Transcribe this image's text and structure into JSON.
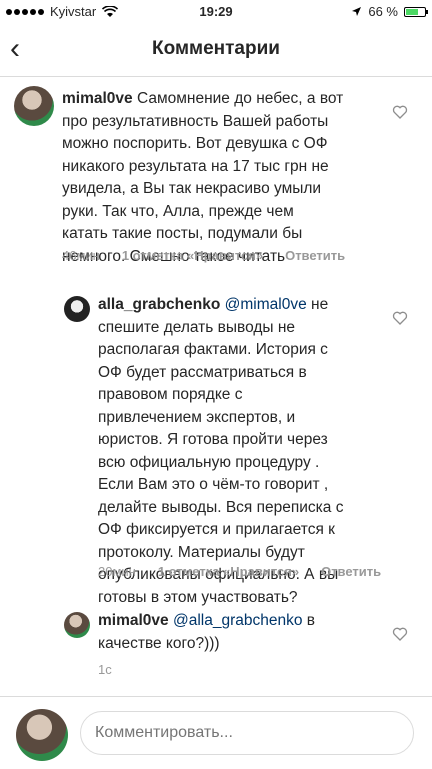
{
  "status": {
    "carrier": "Kyivstar",
    "time": "19:29",
    "battery": "66 %",
    "battery_level": 0.66
  },
  "header": {
    "title": "Комментарии"
  },
  "comments": [
    {
      "user": "mimal0ve",
      "lines": [
        "Самомнение до небес, а вот",
        "про результативность Вашей работы",
        "можно поспорить. Вот девушка с ОФ",
        "никакого результата на 17 тыс грн не",
        "увидела, а Вы так некрасиво умыли",
        "руки. Так что, Алла, прежде чем",
        "катать такие посты, подумали бы",
        "немного. Смешно такое читать"
      ],
      "time": "46мин",
      "likes": "1 отметка «Нравится»",
      "reply": "Ответить"
    },
    {
      "user": "alla_grabchenko",
      "mention": "@mimal0ve",
      "lines": [
        "не",
        "спешите делать выводы не",
        "располагая фактами. История с",
        "ОФ будет рассматриваться в",
        "правовом порядке с",
        "привлечением  экспертов, и",
        "юристов. Я готова пройти через",
        "всю официальную процедуру .",
        "Если Вам это о чём-то говорит ,",
        "делайте выводы. Вся переписка с",
        "ОФ фиксируется и прилагается к",
        "протоколу.  Материалы будут",
        "опубликованы официально. А вы",
        "готовы в этом участвовать?"
      ],
      "time": "20мин",
      "likes": "1 отметка «Нравится»",
      "reply": "Ответить"
    },
    {
      "user": "mimal0ve",
      "mention": "@alla_grabchenko",
      "lines": [
        "в",
        "качестве кого?)))"
      ],
      "time": "1с"
    }
  ],
  "composer": {
    "placeholder": "Комментировать..."
  }
}
